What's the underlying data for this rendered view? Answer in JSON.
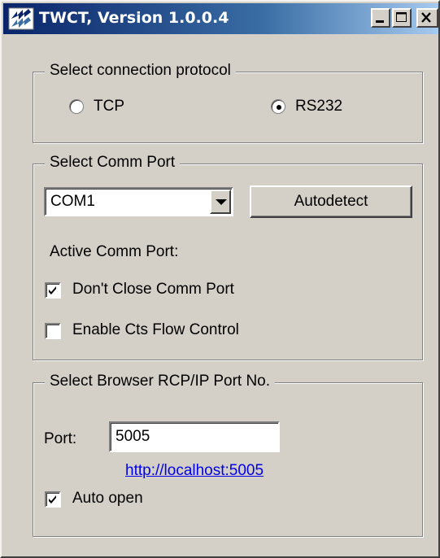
{
  "window": {
    "title": "TWCT, Version 1.0.0.4",
    "icon": "twct-app-icon",
    "controls": {
      "minimize_icon": "minimize-icon",
      "maximize_icon": "maximize-icon",
      "close_icon": "close-icon"
    }
  },
  "protocol_group": {
    "legend": "Select connection protocol",
    "options": [
      {
        "label": "TCP",
        "selected": false
      },
      {
        "label": "RS232",
        "selected": true
      }
    ]
  },
  "comm_group": {
    "legend": "Select Comm Port",
    "port_select": {
      "value": "COM1",
      "options": [
        "COM1"
      ]
    },
    "autodetect_label": "Autodetect",
    "active_comm_label": "Active Comm Port:",
    "active_comm_value": "",
    "checkboxes": [
      {
        "label": "Don't Close Comm Port",
        "checked": true
      },
      {
        "label": "Enable Cts Flow Control",
        "checked": false
      }
    ]
  },
  "browser_group": {
    "legend": "Select Browser RCP/IP Port No.",
    "port_label": "Port:",
    "port_value": "5005",
    "link_text": "http://localhost:5005",
    "auto_open": {
      "label": "Auto open",
      "checked": true
    }
  },
  "colors": {
    "face": "#d4d0c8",
    "title_start": "#0a246a",
    "title_end": "#a6caf0",
    "link": "#0000ee"
  }
}
